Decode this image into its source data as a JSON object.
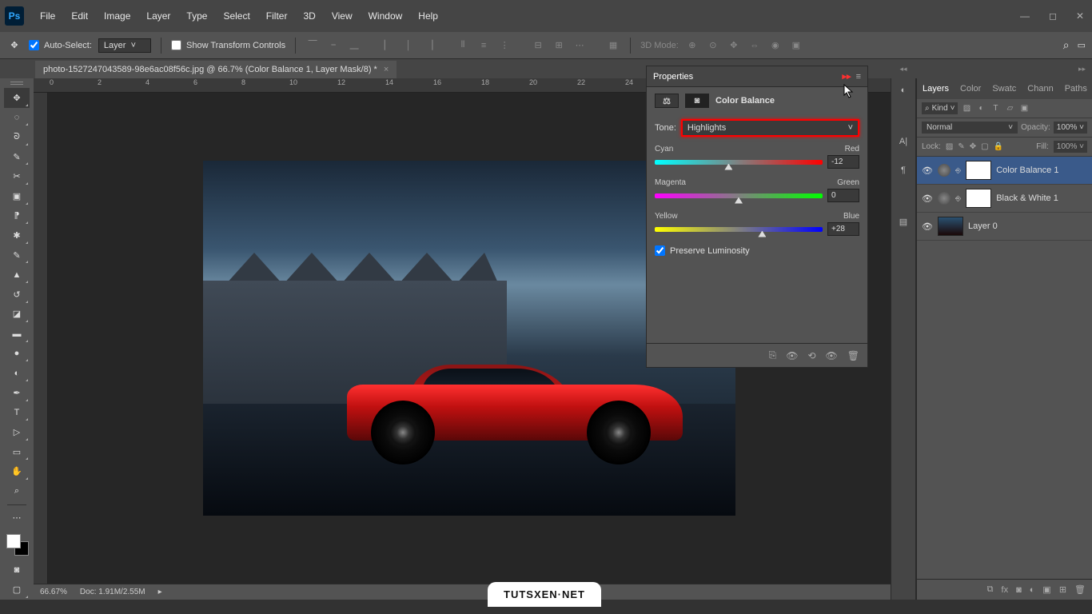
{
  "menu": [
    "File",
    "Edit",
    "Image",
    "Layer",
    "Type",
    "Select",
    "Filter",
    "3D",
    "View",
    "Window",
    "Help"
  ],
  "optbar": {
    "auto_select": "Auto-Select:",
    "auto_select_target": "Layer",
    "show_transform": "Show Transform Controls",
    "mode3d": "3D Mode:"
  },
  "doctab": {
    "title": "photo-1527247043589-98e6ac08f56c.jpg @ 66.7% (Color Balance 1, Layer Mask/8) *"
  },
  "ruler_h": [
    "0",
    "2",
    "4",
    "6",
    "8",
    "10",
    "12",
    "14",
    "16",
    "18",
    "20",
    "22",
    "24"
  ],
  "properties": {
    "panel_label": "Properties",
    "title": "Color Balance",
    "tone_label": "Tone:",
    "tone_value": "Highlights",
    "sliders": {
      "cr": {
        "left": "Cyan",
        "right": "Red",
        "value": "-12",
        "pct": 44
      },
      "mg": {
        "left": "Magenta",
        "right": "Green",
        "value": "0",
        "pct": 50
      },
      "yb": {
        "left": "Yellow",
        "right": "Blue",
        "value": "+28",
        "pct": 64
      }
    },
    "preserve": "Preserve Luminosity"
  },
  "panels": {
    "tabs": [
      "Layers",
      "Color",
      "Swatc",
      "Chann",
      "Paths"
    ],
    "kind": "Kind",
    "blend": "Normal",
    "opacity_l": "Opacity:",
    "opacity_v": "100%",
    "lock_l": "Lock:",
    "fill_l": "Fill:",
    "fill_v": "100%",
    "layers": [
      {
        "name": "Color Balance 1",
        "type": "adj",
        "sel": true
      },
      {
        "name": "Black & White 1",
        "type": "adj",
        "sel": false
      },
      {
        "name": "Layer 0",
        "type": "img",
        "sel": false
      }
    ]
  },
  "status": {
    "zoom": "66.67%",
    "doc": "Doc: 1.91M/2.55M"
  },
  "watermark": "TUTSXEN·NET"
}
